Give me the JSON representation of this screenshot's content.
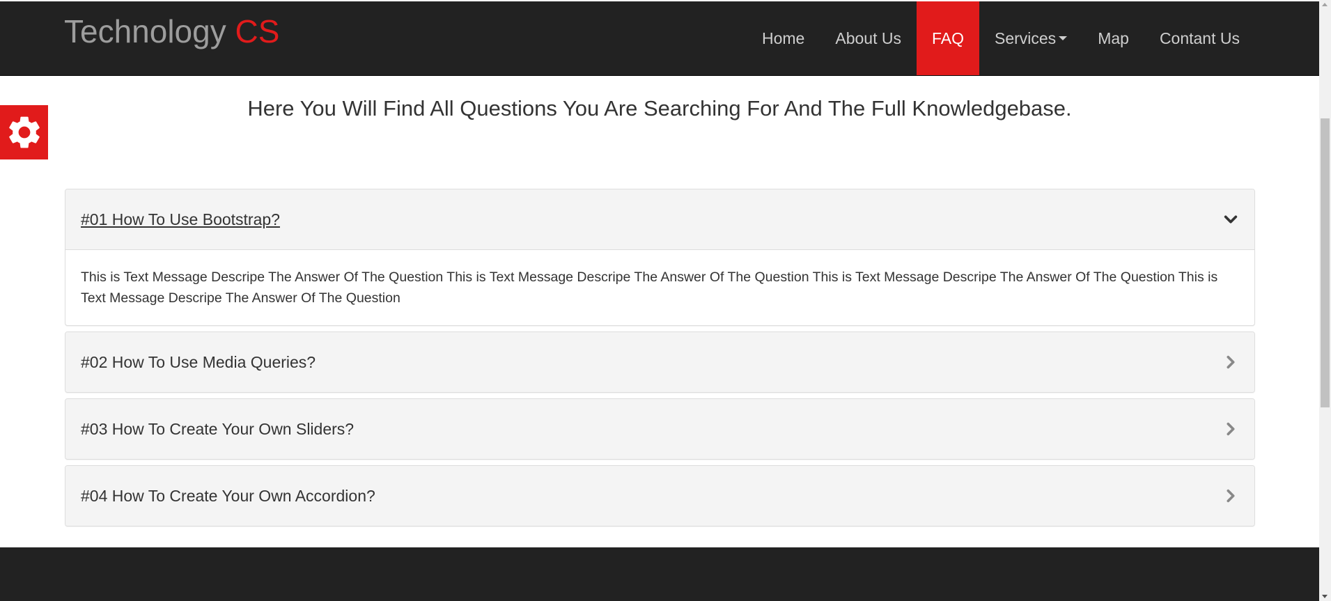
{
  "brand": {
    "name": "Technology",
    "accent": "CS"
  },
  "nav": {
    "items": [
      {
        "label": "Home"
      },
      {
        "label": "About Us"
      },
      {
        "label": "FAQ"
      },
      {
        "label": "Services"
      },
      {
        "label": "Map"
      },
      {
        "label": "Contant Us"
      }
    ],
    "active": "FAQ"
  },
  "settings": {
    "icon": "gear-icon"
  },
  "heading": "Here You Will Find All Questions You Are Searching For And The Full Knowledgebase.",
  "faq": {
    "items": [
      {
        "title": "#01 How To Use Bootstrap?",
        "expanded": true,
        "icon": "chevron-down-icon",
        "body": "This is Text Message Descripe The Answer Of The Question This is Text Message Descripe The Answer Of The Question This is Text Message Descripe The Answer Of The Question This is Text Message Descripe The Answer Of The Question"
      },
      {
        "title": "#02 How To Use Media Queries?",
        "expanded": false,
        "icon": "chevron-right-icon"
      },
      {
        "title": "#03 How To Create Your Own Sliders?",
        "expanded": false,
        "icon": "chevron-right-icon"
      },
      {
        "title": "#04 How To Create Your Own Accordion?",
        "expanded": false,
        "icon": "chevron-right-icon"
      }
    ]
  },
  "colors": {
    "navbar_bg": "#222222",
    "accent": "#e11b1b",
    "panel_heading_bg": "#f4f4f4",
    "text": "#333333"
  }
}
